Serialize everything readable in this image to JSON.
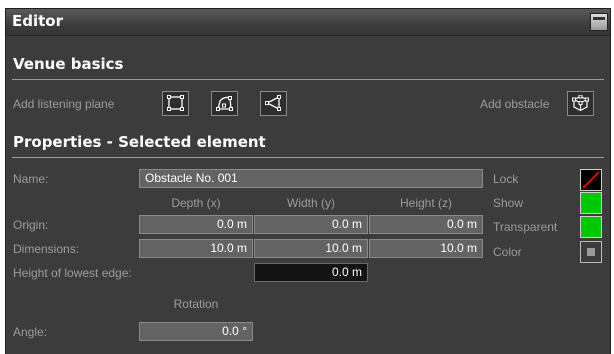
{
  "editor": {
    "title": "Editor"
  },
  "venue_basics": {
    "heading": "Venue basics",
    "add_listening_plane_label": "Add listening plane",
    "add_obstacle_label": "Add obstacle",
    "plane_icons": [
      "rectangle-plane-icon",
      "curved-plane-icon",
      "triangle-plane-icon"
    ],
    "obstacle_icon": "cube-obstacle-icon"
  },
  "properties": {
    "heading": "Properties - Selected element",
    "name_label": "Name:",
    "name_value": "Obstacle No. 001",
    "col_headers": {
      "depth": "Depth (x)",
      "width": "Width (y)",
      "height": "Height (z)"
    },
    "origin_label": "Origin:",
    "origin": {
      "x": "0.0 m",
      "y": "0.0 m",
      "z": "0.0 m"
    },
    "dimensions_label": "Dimensions:",
    "dimensions": {
      "x": "10.0 m",
      "y": "10.0 m",
      "z": "10.0 m"
    },
    "lowest_edge_label": "Height of lowest edge:",
    "lowest_edge_value": "0.0 m",
    "rotation_header": "Rotation",
    "angle_label": "Angle:",
    "angle_value": "0.0 °",
    "lock_label": "Lock",
    "show_label": "Show",
    "transparent_label": "Transparent",
    "color_label": "Color",
    "lock_checked": false,
    "show_checked": true,
    "transparent_checked": true
  },
  "colors": {
    "panel_bg": "#3c3c3c",
    "checked_green": "#00c800",
    "lock_slash_red": "#e00000",
    "label_gray": "#9c9c9c"
  }
}
